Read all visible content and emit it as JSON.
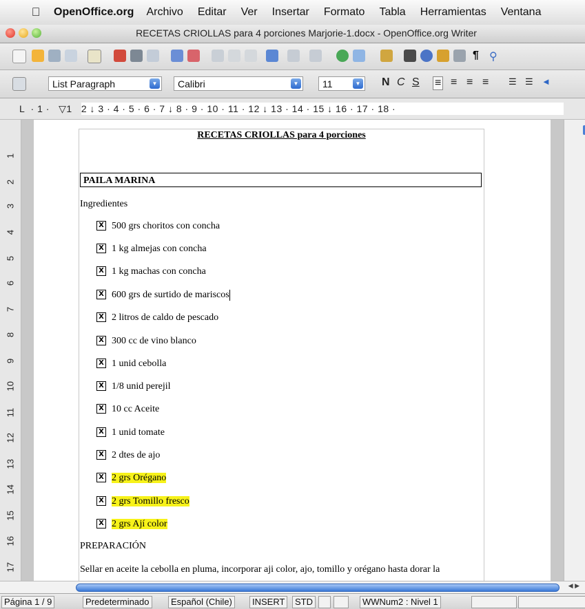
{
  "menubar": {
    "app": "OpenOffice.org",
    "items": [
      "Archivo",
      "Editar",
      "Ver",
      "Insertar",
      "Formato",
      "Tabla",
      "Herramientas",
      "Ventana"
    ]
  },
  "window": {
    "title": "RECETAS CRIOLLAS para 4 porciones Marjorie-1.docx - OpenOffice.org Writer"
  },
  "toolbar": {
    "icons": [
      "new-document-icon",
      "open-icon",
      "save-icon",
      "email-icon",
      "edit-mode-icon",
      "export-pdf-icon",
      "print-icon",
      "page-preview-icon",
      "spellcheck-icon",
      "autospellcheck-icon",
      "cut-icon",
      "copy-icon",
      "paste-icon",
      "clone-formatting-icon",
      "undo-icon",
      "redo-icon",
      "hyperlink-icon",
      "table-icon",
      "draw-functions-icon",
      "find-replace-icon",
      "navigator-icon",
      "gallery-icon",
      "data-sources-icon",
      "formatting-marks-icon",
      "zoom-icon"
    ]
  },
  "format": {
    "style": "List Paragraph",
    "font": "Calibri",
    "size": "11",
    "bold": "N",
    "italic": "C",
    "underline": "S"
  },
  "ruler": {
    "text": "L  · 1 ·   ▽1   2 ↓ 3 · 4 · 5 · 6 · 7 ↓ 8 · 9 · 10 · 11 · 12 ↓ 13 · 14 · 15 ↓ 16 · 17 · 18 ·"
  },
  "vruler": [
    "1",
    "2",
    "3",
    "4",
    "5",
    "6",
    "7",
    "8",
    "9",
    "10",
    "11",
    "12",
    "13",
    "14",
    "15",
    "16",
    "17"
  ],
  "document": {
    "title": "RECETAS CRIOLLAS para 4 porciones",
    "section": "PAILA MARINA",
    "ingredients_label": "Ingredientes",
    "checkbox_mark": "X",
    "items": [
      {
        "text": "500 grs choritos con concha"
      },
      {
        "text": "1 kg almejas con concha"
      },
      {
        "text": "1 kg machas con concha"
      },
      {
        "text": "600 grs de surtido de mariscos"
      },
      {
        "text": "2 litros de caldo de pescado"
      },
      {
        "text": "300 cc de vino blanco"
      },
      {
        "text": "1 unid cebolla"
      },
      {
        "text": "1/8 unid perejil"
      },
      {
        "text": "10 cc Aceite"
      },
      {
        "text": "1 unid tomate"
      },
      {
        "text": "2 dtes de ajo"
      },
      {
        "text": "2 grs Orégano",
        "highlight": true
      },
      {
        "text": "2 grs Tomillo fresco",
        "highlight": true
      },
      {
        "text": "2 grs Ají color",
        "highlight": true
      }
    ],
    "preparation_label": "PREPARACIÓN",
    "preparation_text": "Sellar en aceite la cebolla en pluma, incorporar aji color, ajo, tomillo y orégano hasta dorar la",
    "highlight_color": "#f7f21a"
  },
  "statusbar": {
    "page": "Página  1 / 9",
    "style": "Predeterminado",
    "language": "Español (Chile)",
    "mode": "INSERT",
    "selection": "STD",
    "list": "WWNum2 : Nivel  1"
  }
}
